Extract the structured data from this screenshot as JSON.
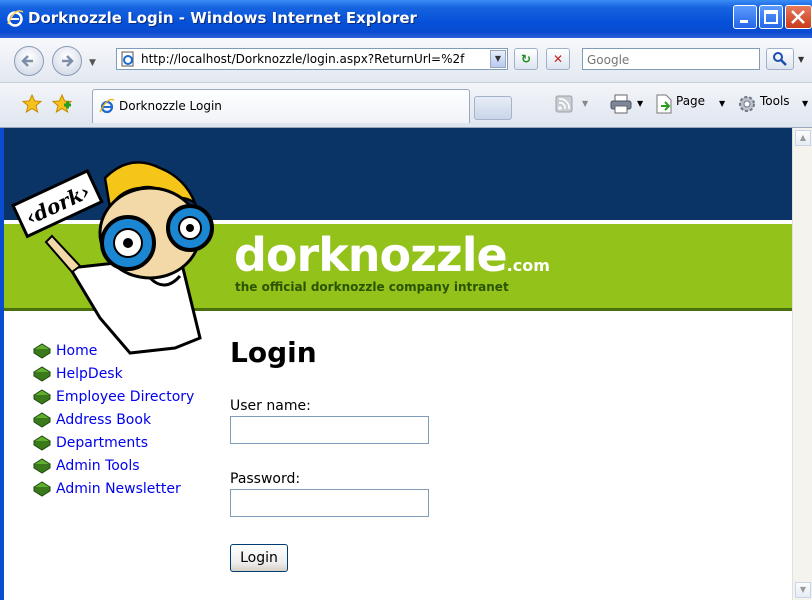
{
  "window": {
    "title": "Dorknozzle Login - Windows Internet Explorer"
  },
  "toolbar": {
    "address": "http://localhost/Dorknozzle/login.aspx?ReturnUrl=%2f",
    "search_placeholder": "Google",
    "tab_label": "Dorknozzle Login",
    "page_menu": "Page",
    "tools_menu": "Tools"
  },
  "header": {
    "brand": "dorknozzle",
    "brand_suffix": ".com",
    "tagline": "the official dorknozzle company intranet",
    "mascot_sign": "‹dork›"
  },
  "menu": {
    "items": [
      {
        "label": "Home"
      },
      {
        "label": "HelpDesk"
      },
      {
        "label": "Employee Directory"
      },
      {
        "label": "Address Book"
      },
      {
        "label": "Departments"
      },
      {
        "label": "Admin Tools"
      },
      {
        "label": "Admin Newsletter"
      }
    ]
  },
  "login": {
    "heading": "Login",
    "username_label": "User name:",
    "username_value": "",
    "password_label": "Password:",
    "password_value": "",
    "button_label": "Login"
  },
  "colors": {
    "header_navy": "#0b3466",
    "header_green": "#93c21a",
    "link": "#0000ee"
  }
}
